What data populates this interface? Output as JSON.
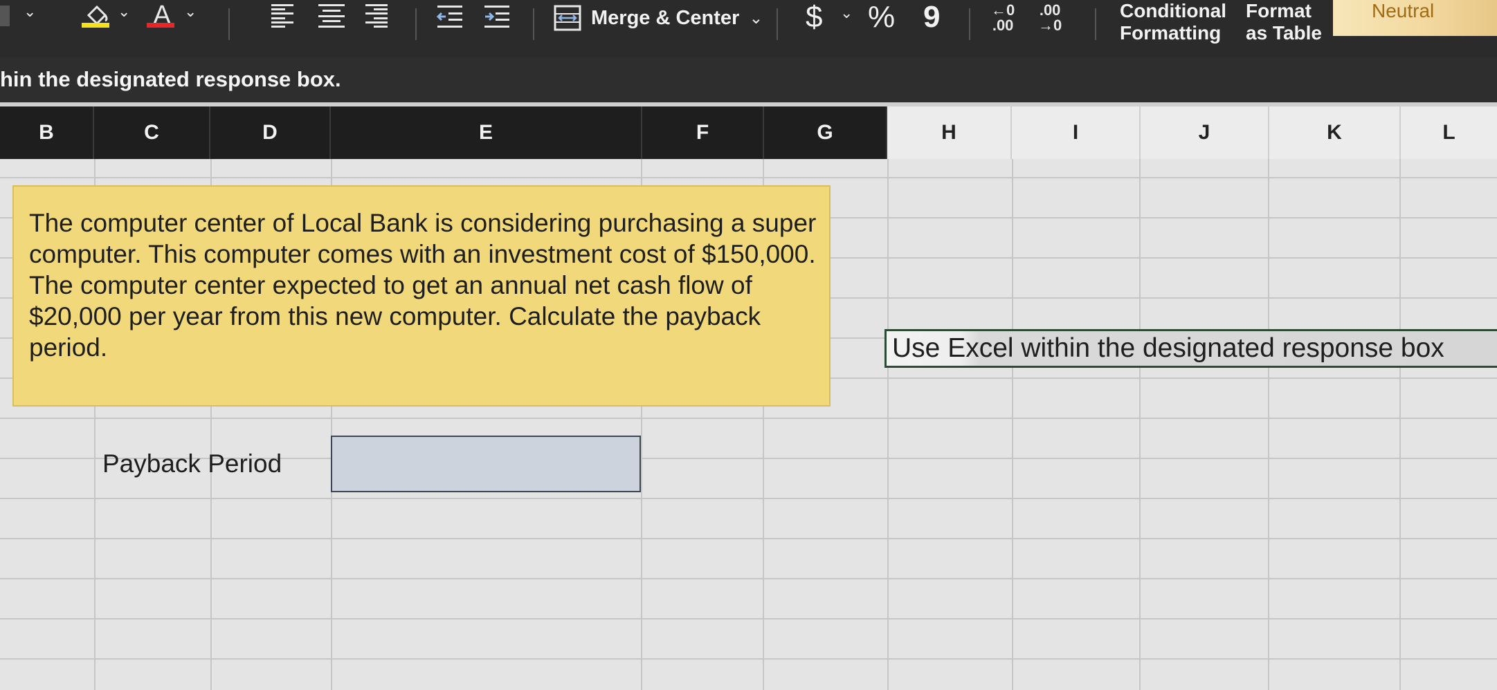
{
  "ribbon": {
    "font_color_letter": "A",
    "merge_center_label": "Merge & Center",
    "currency_symbol": "$",
    "percent_symbol": "%",
    "comma_symbol": "9",
    "increase_decimal_top": "←0",
    "increase_decimal_bottom": ".00",
    "decrease_decimal_top": ".00",
    "decrease_decimal_bottom": "→0",
    "conditional_formatting_line1": "Conditional",
    "conditional_formatting_line2": "Formatting",
    "format_table_line1": "Format",
    "format_table_line2": "as Table",
    "style_neutral_label": "Neutral",
    "icons": [
      "fill-color-icon",
      "font-color-icon",
      "align-left-icon",
      "align-center-icon",
      "align-right-icon",
      "decrease-indent-icon",
      "increase-indent-icon",
      "merge-icon"
    ],
    "colors": {
      "fill_color": "#f4e01c",
      "font_color": "#e8262a"
    }
  },
  "formula_bar": {
    "text": "hin the designated response box."
  },
  "columns": [
    "B",
    "C",
    "D",
    "E",
    "F",
    "G",
    "H",
    "I",
    "J",
    "K",
    "L"
  ],
  "sheet": {
    "question_text": "The computer center of Local Bank is considering purchasing a super computer.  This computer comes with an investment cost of $150,000.  The computer center expected to get an annual net cash flow of $20,000 per year from this new computer. Calculate the payback period.",
    "payback_label": "Payback Period",
    "answer_value": "",
    "response_note": "Use Excel within the designated response box",
    "colors": {
      "question_fill": "#f1d87a",
      "answer_fill": "#cdd3dc"
    }
  }
}
